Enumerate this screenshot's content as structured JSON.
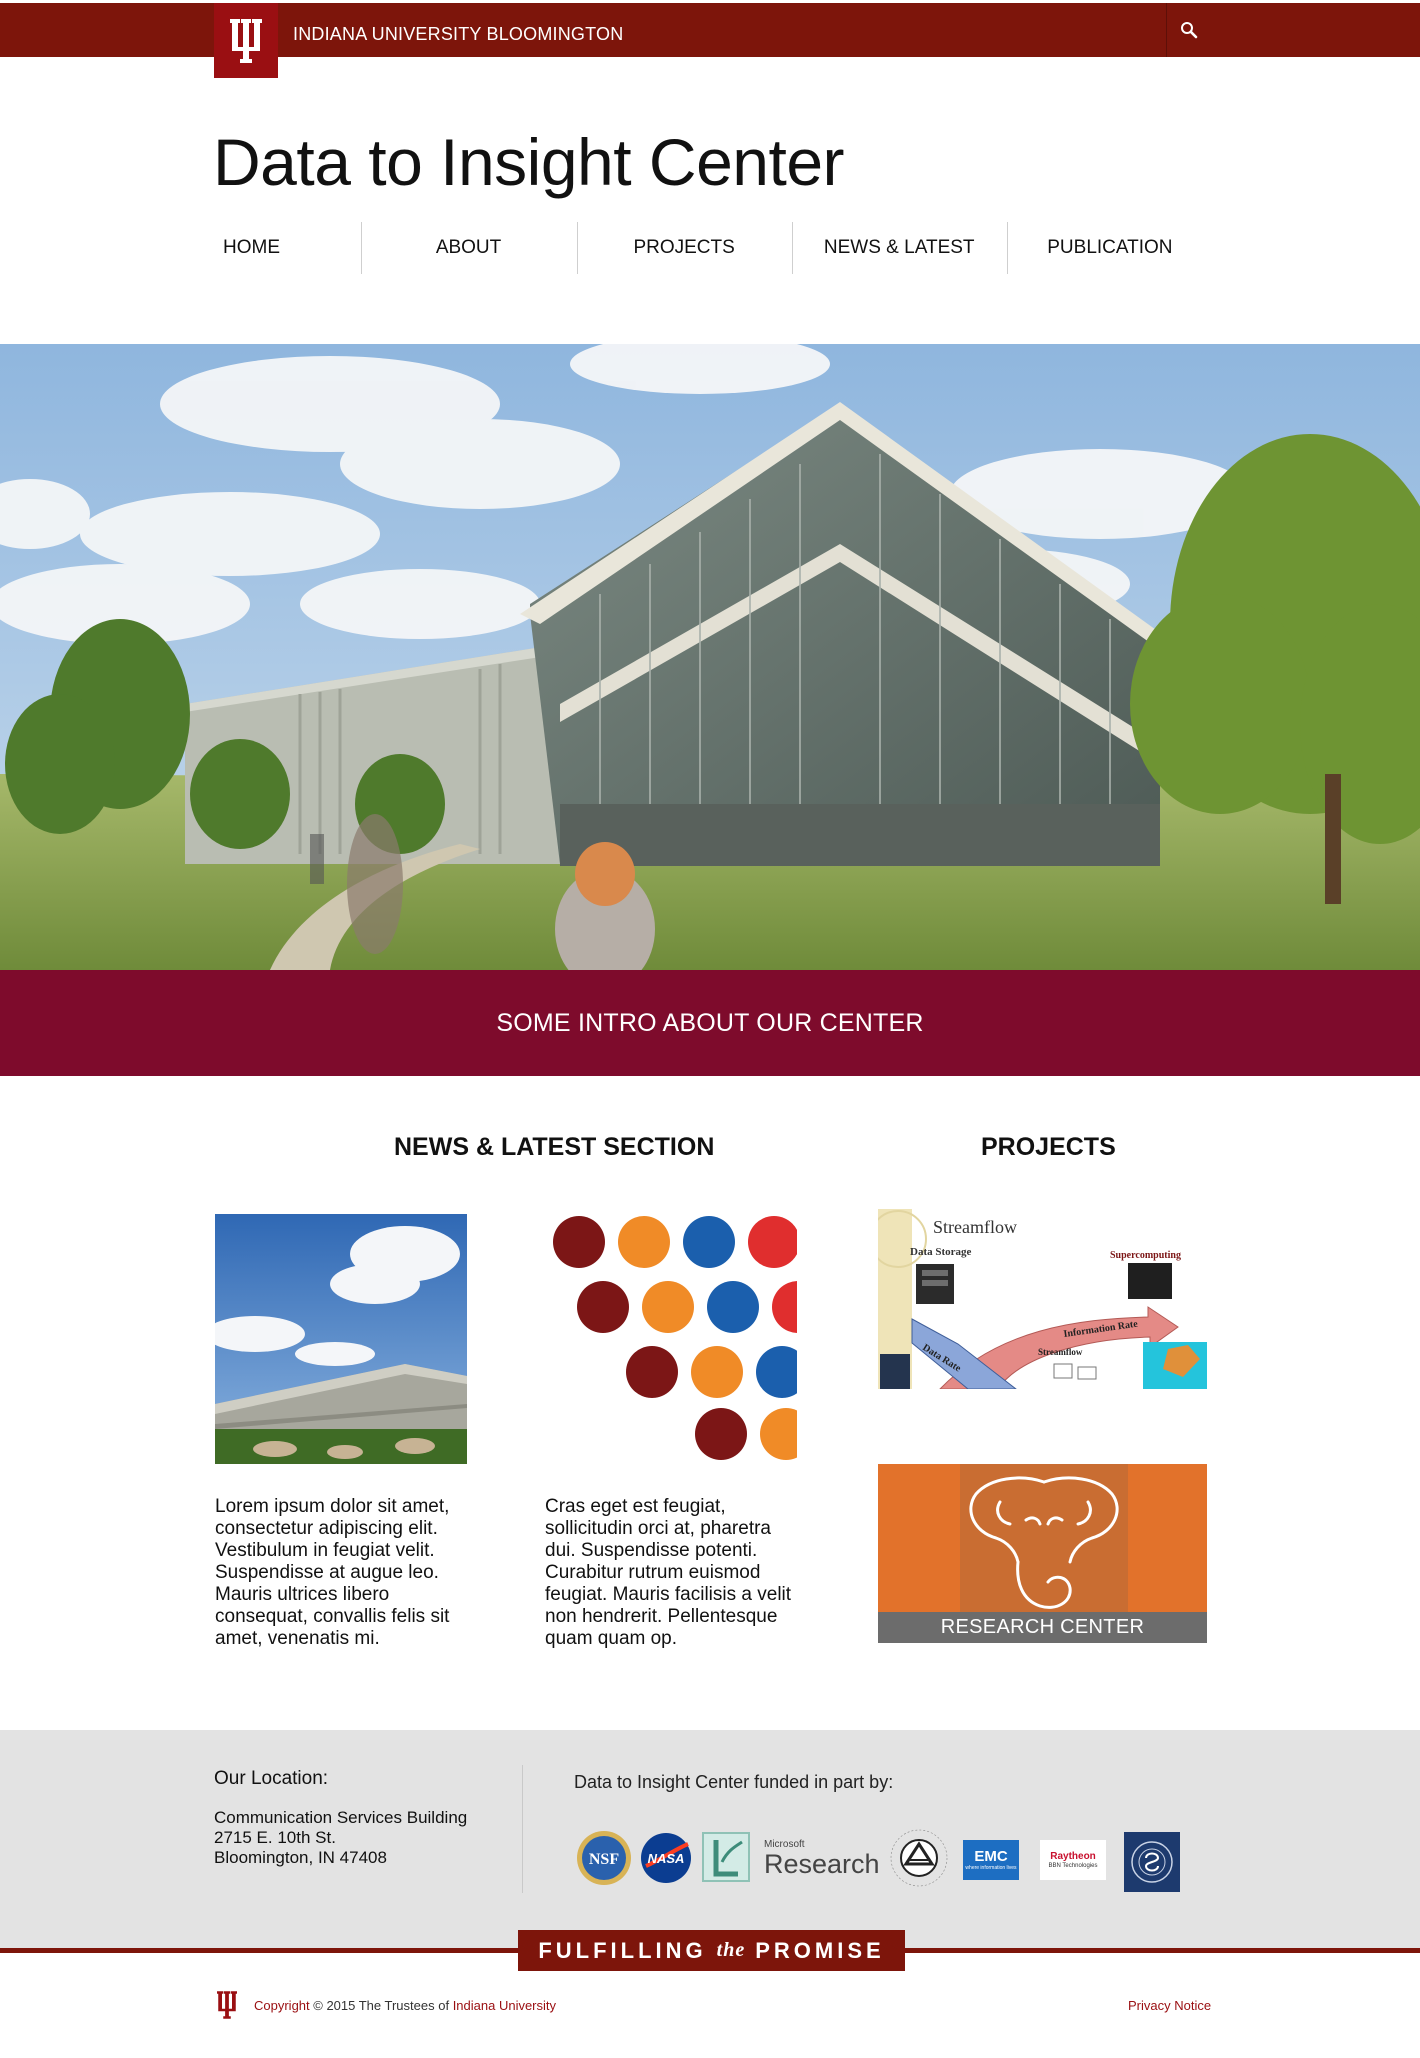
{
  "iu_bar": {
    "university_name": "INDIANA UNIVERSITY BLOOMINGTON",
    "brand_color": "#7d150b",
    "search_icon": "search-icon"
  },
  "site": {
    "title": "Data to Insight Center"
  },
  "nav": {
    "items": [
      "HOME",
      "ABOUT",
      "PROJECTS",
      "NEWS & LATEST",
      "PUBLICATION"
    ]
  },
  "hero": {
    "intro_text": "SOME INTRO ABOUT OUR CENTER",
    "band_color": "#7e0b2c"
  },
  "news": {
    "heading": "NEWS & LATEST SECTION",
    "items": [
      {
        "lines": [
          "Lorem ipsum dolor sit amet,",
          "consectetur adipiscing elit.",
          "Vestibulum in feugiat velit.",
          "Suspendisse at augue leo.",
          "Mauris ultrices libero",
          "consequat, convallis felis sit",
          "amet, venenatis mi."
        ]
      },
      {
        "lines": [
          "Cras eget est feugiat,",
          "sollicitudin orci at, pharetra",
          "dui. Suspendisse potenti.",
          "Curabitur rutrum euismod",
          "feugiat. Mauris facilisis a velit",
          "non hendrerit. Pellentesque",
          "quam quam op."
        ]
      }
    ]
  },
  "projects": {
    "heading": "PROJECTS",
    "streamflow": {
      "title": "Streamflow",
      "data_storage": "Data Storage",
      "supercomputing": "Supercomputing",
      "information_rate": "Information Rate",
      "data_rate": "Data Rate",
      "streamflow_small": "Streamflow"
    },
    "research_center_label": "RESEARCH CENTER"
  },
  "footer": {
    "location_heading": "Our Location:",
    "address_lines": [
      "Communication Services Building",
      "2715 E. 10th St.",
      "Bloomington, IN 47408"
    ],
    "funded_text": "Data to Insight Center funded in part by:",
    "sponsors": {
      "nsf": "NSF",
      "nasa": "NASA",
      "microsoft_small": "Microsoft",
      "microsoft_big": "Research",
      "nih": "NATIONAL INSTITUTES OF HEALTH",
      "emc": "EMC",
      "emc_sub": "where information lives",
      "raytheon": "Raytheon",
      "raytheon_sub": "BBN Technologies"
    },
    "promise_left": "FULFILLING",
    "promise_the": "the",
    "promise_right": "PROMISE",
    "copyright_prefix": "Copyright",
    "copyright_middle": " © 2015 The Trustees of ",
    "copyright_link": "Indiana University",
    "privacy": "Privacy Notice"
  }
}
